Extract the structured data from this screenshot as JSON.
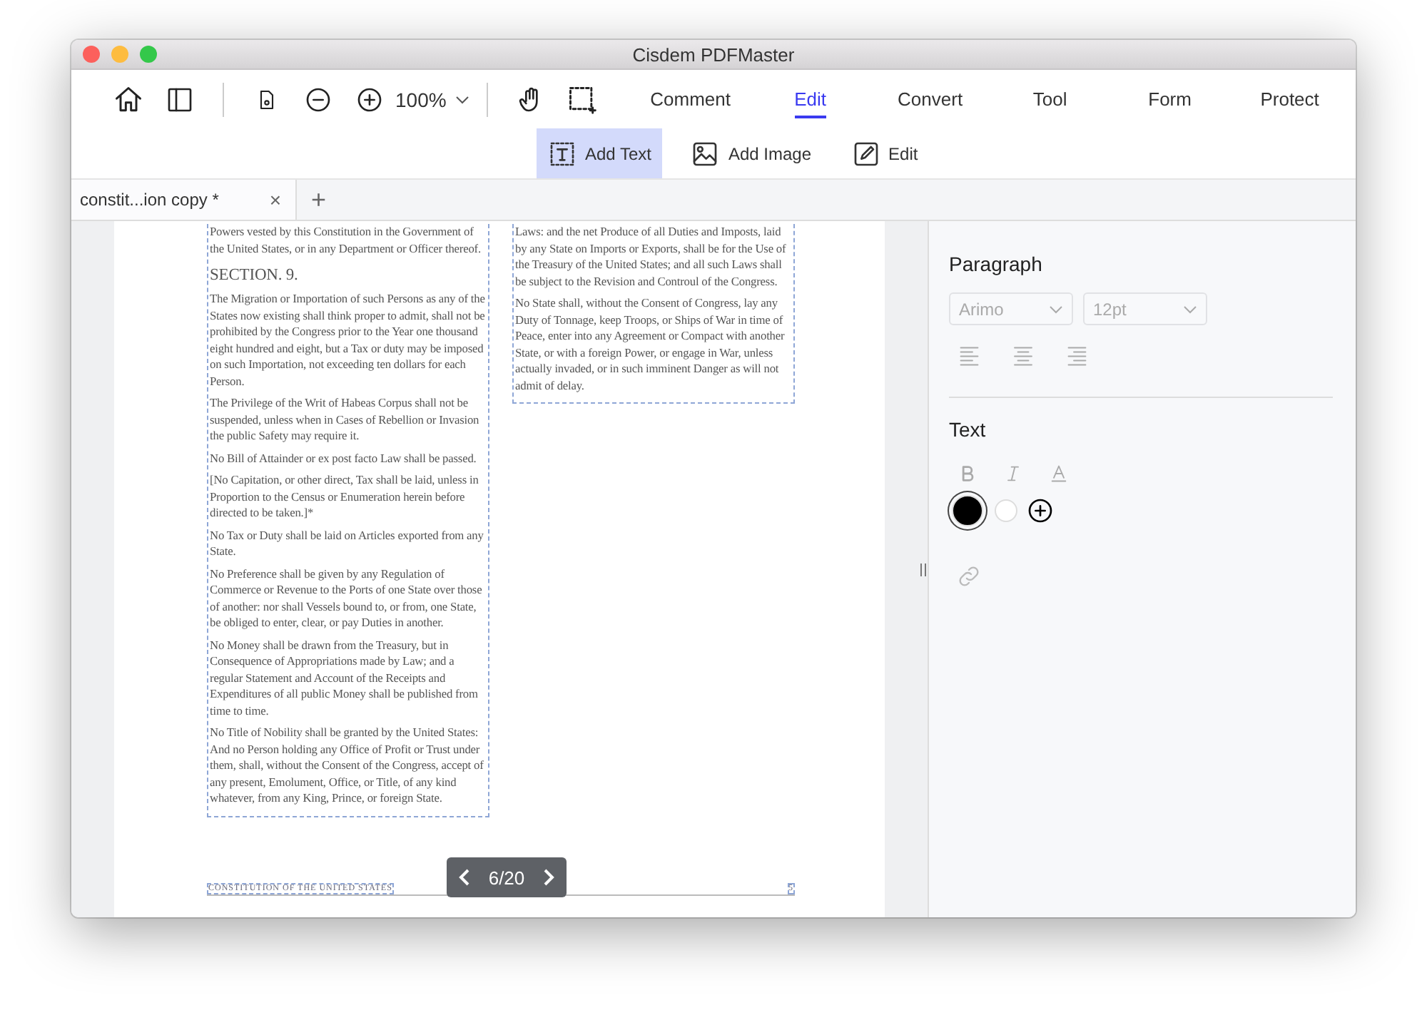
{
  "window": {
    "title": "Cisdem PDFMaster"
  },
  "toolbar": {
    "zoom": "100%",
    "tabs": [
      {
        "label": "Comment",
        "selected": false
      },
      {
        "label": "Edit",
        "selected": true
      },
      {
        "label": "Convert",
        "selected": false
      },
      {
        "label": "Tool",
        "selected": false
      },
      {
        "label": "Form",
        "selected": false
      },
      {
        "label": "Protect",
        "selected": false
      }
    ]
  },
  "edit_tools": [
    {
      "kind": "text",
      "label": "Add Text",
      "selected": true
    },
    {
      "kind": "image",
      "label": "Add Image",
      "selected": false
    },
    {
      "kind": "edit",
      "label": "Edit",
      "selected": false
    }
  ],
  "doc_tabs": [
    {
      "label": "constit...ion copy *",
      "close": "×",
      "selected": true
    }
  ],
  "new_tab": "+",
  "page": {
    "left_column": [
      {
        "kind": "paragraph",
        "text": "Powers vested by this Constitution in the Government of the United States, or in any Department or Officer thereof."
      },
      {
        "kind": "heading",
        "text": "SECTION. 9."
      },
      {
        "kind": "paragraph",
        "text": "The Migration or Importation of such Persons as any of the States now existing shall think proper to admit, shall not be prohibited by the Congress prior to the Year one thousand eight hundred and eight, but a Tax or duty may be imposed on such Importation, not exceeding ten dollars for each Person."
      },
      {
        "kind": "paragraph",
        "text": "The Privilege of the Writ of Habeas Corpus shall not be suspended, unless when in Cases of Rebellion or Invasion the public Safety may require it."
      },
      {
        "kind": "paragraph",
        "text": "No Bill of Attainder or ex post facto Law shall be passed."
      },
      {
        "kind": "paragraph",
        "text": "[No Capitation, or other direct, Tax shall be laid, unless in Proportion to the Census or Enumeration herein before directed to be taken.]*"
      },
      {
        "kind": "paragraph",
        "text": "No Tax or Duty shall be laid on Articles exported from any State."
      },
      {
        "kind": "paragraph",
        "text": "No Preference shall be given by any Regulation of Commerce or Revenue to the Ports of one State over those of another: nor shall Vessels bound to, or from, one State, be obliged to enter, clear, or pay Duties in another."
      },
      {
        "kind": "paragraph",
        "text": "No Money shall be drawn from the Treasury, but in Consequence of Appropriations made by Law; and a regular Statement and Account of the Receipts and Expenditures of all public Money shall be published from time to time."
      },
      {
        "kind": "paragraph",
        "text": "No Title of Nobility shall be granted by the United States: And no Person holding any Office of Profit or Trust under them, shall, without the Consent of the Congress, accept of any present, Emolument, Office, or Title, of any kind whatever, from any King, Prince, or foreign State."
      }
    ],
    "right_column": [
      {
        "kind": "paragraph",
        "text": "Laws: and the net Produce of all Duties and Imposts, laid by any State on Imports or Exports, shall be for the Use of the Treasury of the United States; and all such Laws shall be subject to the Revision and Controul of the Congress."
      },
      {
        "kind": "paragraph",
        "text": "No State shall, without the Consent of Congress, lay any Duty of Tonnage, keep Troops, or Ships of War in time of Peace, enter into any Agreement or Compact with another State, or with a foreign Power, or engage in War, unless actually invaded, or in such imminent Danger as will not admit of delay."
      }
    ],
    "footer": {
      "title": "CONSTITUTION OF THE UNITED STATES",
      "page_number": "5"
    }
  },
  "pager": {
    "label": "6/20"
  },
  "panel": {
    "paragraph": {
      "title": "Paragraph",
      "font": "Arimo",
      "size": "12pt"
    },
    "text": {
      "title": "Text",
      "colors": [
        {
          "color": "#000000",
          "selected": true
        },
        {
          "color": "#ffffff",
          "selected": false
        }
      ]
    }
  }
}
